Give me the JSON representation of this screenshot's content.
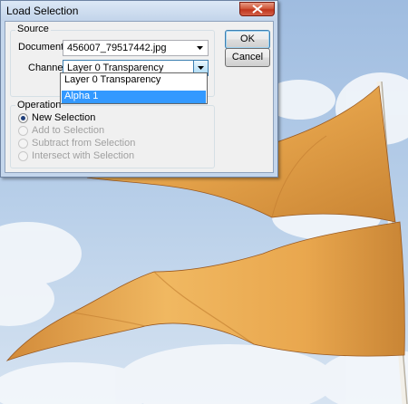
{
  "dialog": {
    "title": "Load Selection",
    "ok_label": "OK",
    "cancel_label": "Cancel",
    "source": {
      "group_label": "Source",
      "document_label": "Document:",
      "document_value": "456007_79517442.jpg",
      "channel_label": "Channel:",
      "channel_value": "Layer 0 Transparency"
    },
    "channel_dropdown": {
      "options": [
        "Layer 0 Transparency",
        "Alpha 1"
      ],
      "highlighted": "Alpha 1"
    },
    "operation": {
      "group_label": "Operation",
      "options": [
        {
          "label": "New Selection",
          "checked": true,
          "enabled": true
        },
        {
          "label": "Add to Selection",
          "checked": false,
          "enabled": false
        },
        {
          "label": "Subtract from Selection",
          "checked": false,
          "enabled": false
        },
        {
          "label": "Intersect with Selection",
          "checked": false,
          "enabled": false
        }
      ]
    }
  },
  "colors": {
    "title_bar": "#c4d6ec",
    "close_button": "#c1361d",
    "selection_highlight": "#3399ff",
    "flag": "#e8a84c"
  },
  "icons": {
    "close": "close-icon",
    "dropdown": "chevron-down-icon"
  }
}
